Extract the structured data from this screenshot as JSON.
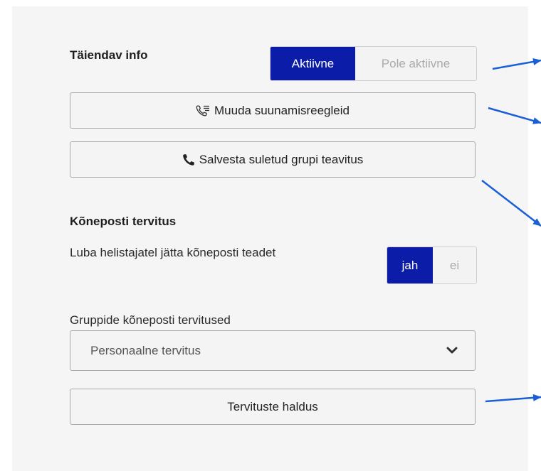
{
  "additional_info": {
    "title": "Täiendav info",
    "status_toggle": {
      "active_label": "Aktiivne",
      "inactive_label": "Pole aktiivne",
      "selected": "Aktiivne"
    },
    "change_routing_button": {
      "label": "Muuda suunamisreegleid",
      "icon": "call-forwarding-icon"
    },
    "save_closed_group_button": {
      "label": "Salvesta suletud grupi teavitus",
      "icon": "phone-icon"
    }
  },
  "voicemail_greeting": {
    "title": "Kõneposti tervitus",
    "allow_label": "Luba helistajatel jätta kõneposti teadet",
    "allow_toggle": {
      "yes_label": "jah",
      "no_label": "ei",
      "selected": "jah"
    },
    "group_greetings_label": "Gruppide kõneposti tervitused",
    "group_greetings_select": {
      "value": "Personaalne tervitus",
      "icon": "chevron-down-icon"
    },
    "manage_greetings_button": {
      "label": "Tervituste haldus"
    }
  },
  "colors": {
    "accent": "#0a1ca8",
    "annotation_arrow": "#1a5fd6",
    "panel_background": "#f5f5f5"
  }
}
